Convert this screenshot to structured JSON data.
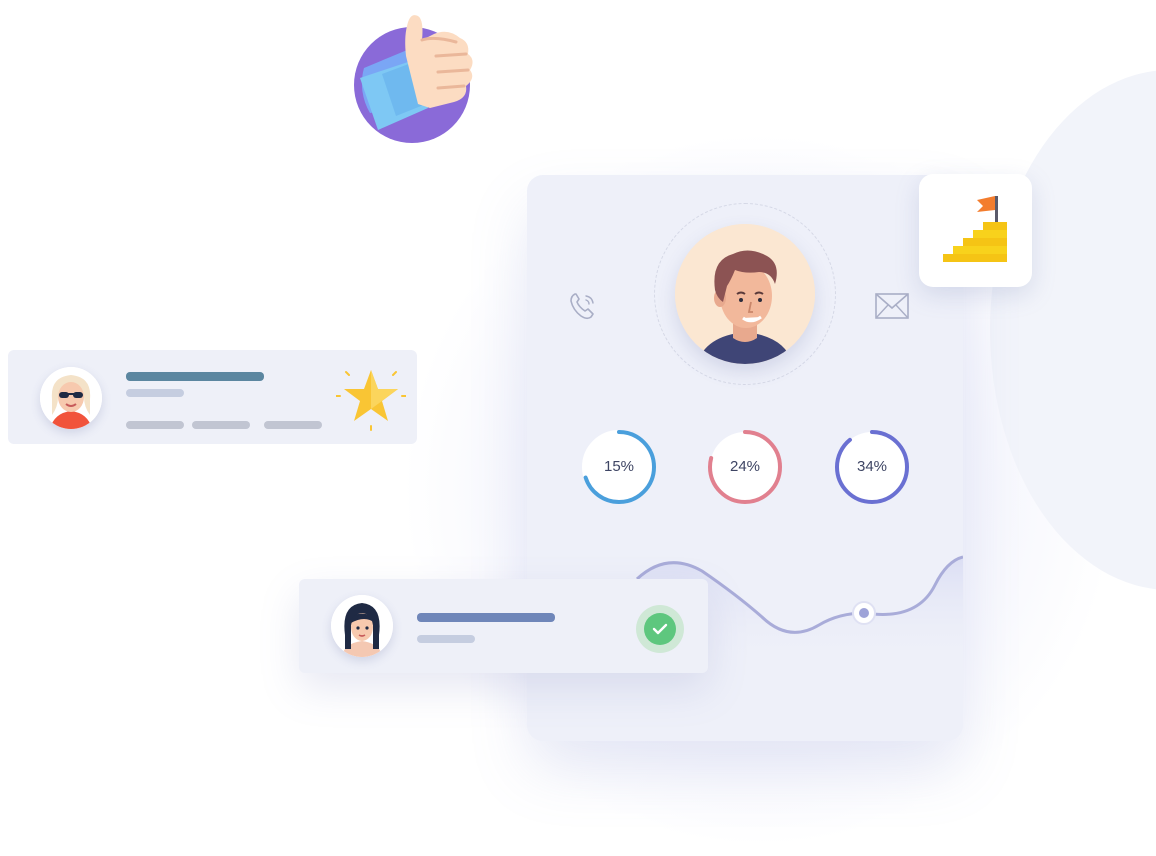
{
  "illustration": {
    "progress_rings": [
      {
        "label": "15%",
        "value": 15,
        "color": "#4a9fdc"
      },
      {
        "label": "24%",
        "value": 24,
        "color": "#e1808f"
      },
      {
        "label": "34%",
        "value": 34,
        "color": "#6a70d2"
      }
    ],
    "icons": [
      "thumbs-up-icon",
      "phone-icon",
      "mail-icon",
      "flag-stairs-icon",
      "star-icon",
      "check-icon"
    ],
    "colors": {
      "card_background": "#eef0f9",
      "wave_line": "#a9acd9",
      "bar_dark": "#5b86a0",
      "bar_light": "#c5cde0",
      "bar_blue": "#6f86b9",
      "check_green": "#5ec77e",
      "star_yellow": "#f9c534",
      "thumb_circle": "#8a6ad8"
    }
  }
}
